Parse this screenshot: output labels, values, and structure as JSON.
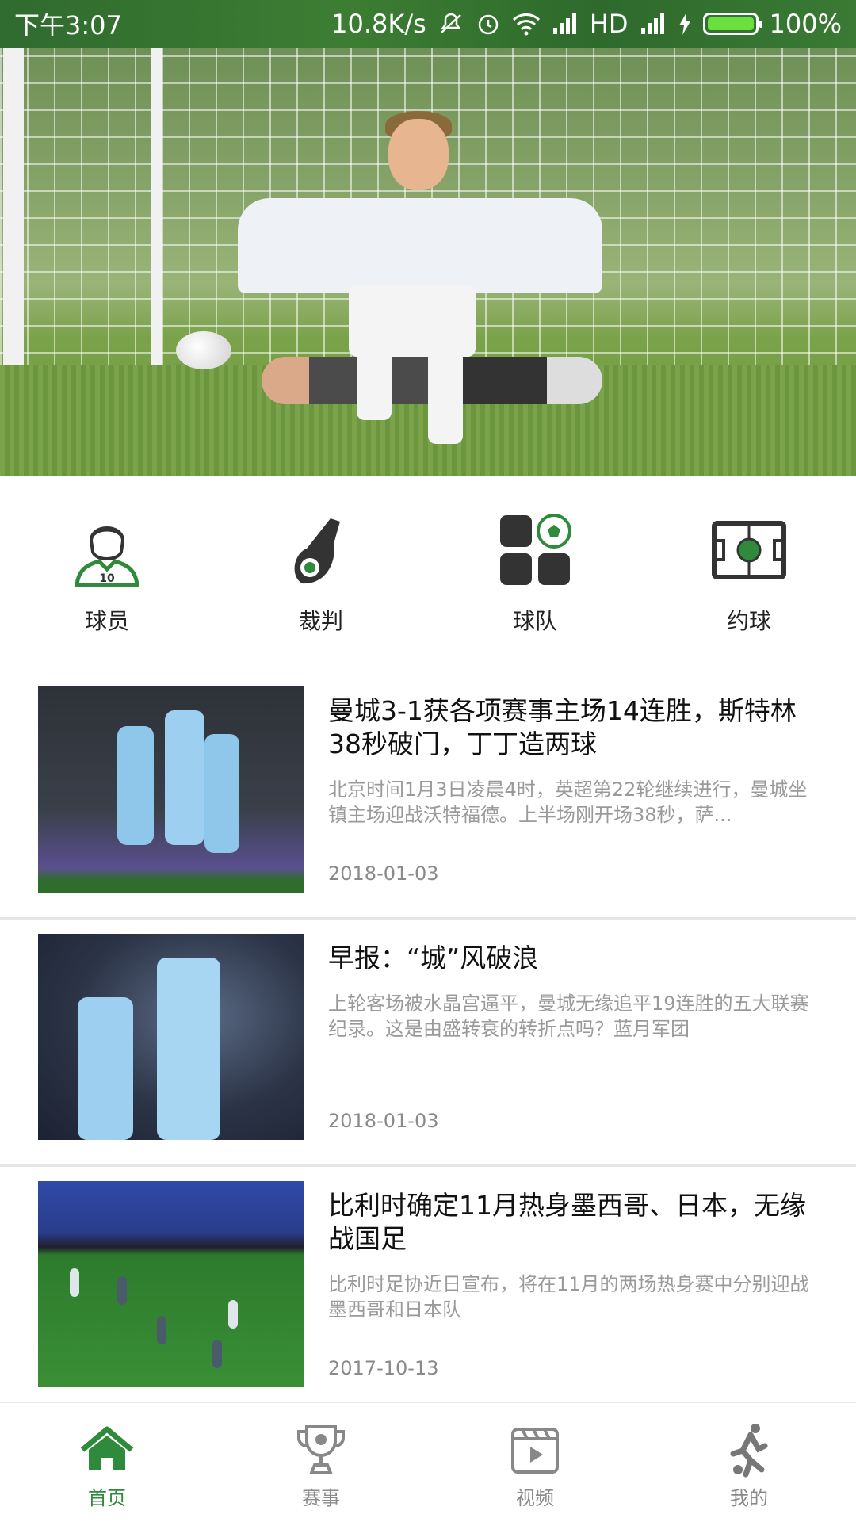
{
  "status_bar": {
    "time": "下午3:07",
    "network_speed": "10.8K/s",
    "hd": "HD",
    "battery": "100%",
    "icons": [
      "mute-icon",
      "alarm-icon",
      "wifi-icon",
      "signal-icon",
      "signal-icon",
      "charging-icon",
      "battery-icon"
    ]
  },
  "categories": [
    {
      "label": "球员",
      "icon": "player-icon"
    },
    {
      "label": "裁判",
      "icon": "whistle-icon"
    },
    {
      "label": "球队",
      "icon": "team-icon"
    },
    {
      "label": "约球",
      "icon": "pitch-icon"
    }
  ],
  "news": [
    {
      "title": "曼城3-1获各项赛事主场14连胜，斯特林38秒破门，丁丁造两球",
      "summary": "北京时间1月3日凌晨4时，英超第22轮继续进行，曼城坐镇主场迎战沃特福德。上半场刚开场38秒，萨...",
      "date": "2018-01-03"
    },
    {
      "title": "早报：“城”风破浪",
      "summary": "上轮客场被水晶宫逼平，曼城无缘追平19连胜的五大联赛纪录。这是由盛转衰的转折点吗？蓝月军团",
      "date": "2018-01-03"
    },
    {
      "title": "比利时确定11月热身墨西哥、日本，无缘战国足",
      "summary": "比利时足协近日宣布，将在11月的两场热身赛中分别迎战墨西哥和日本队",
      "date": "2017-10-13"
    }
  ],
  "bottom_nav": [
    {
      "label": "首页",
      "icon": "home-icon",
      "active": true
    },
    {
      "label": "赛事",
      "icon": "trophy-icon",
      "active": false
    },
    {
      "label": "视频",
      "icon": "video-icon",
      "active": false
    },
    {
      "label": "我的",
      "icon": "profile-icon",
      "active": false
    }
  ],
  "colors": {
    "accent": "#2f8a3b",
    "status_bar": "#3c7d33",
    "text_muted": "#9a9a9a"
  }
}
